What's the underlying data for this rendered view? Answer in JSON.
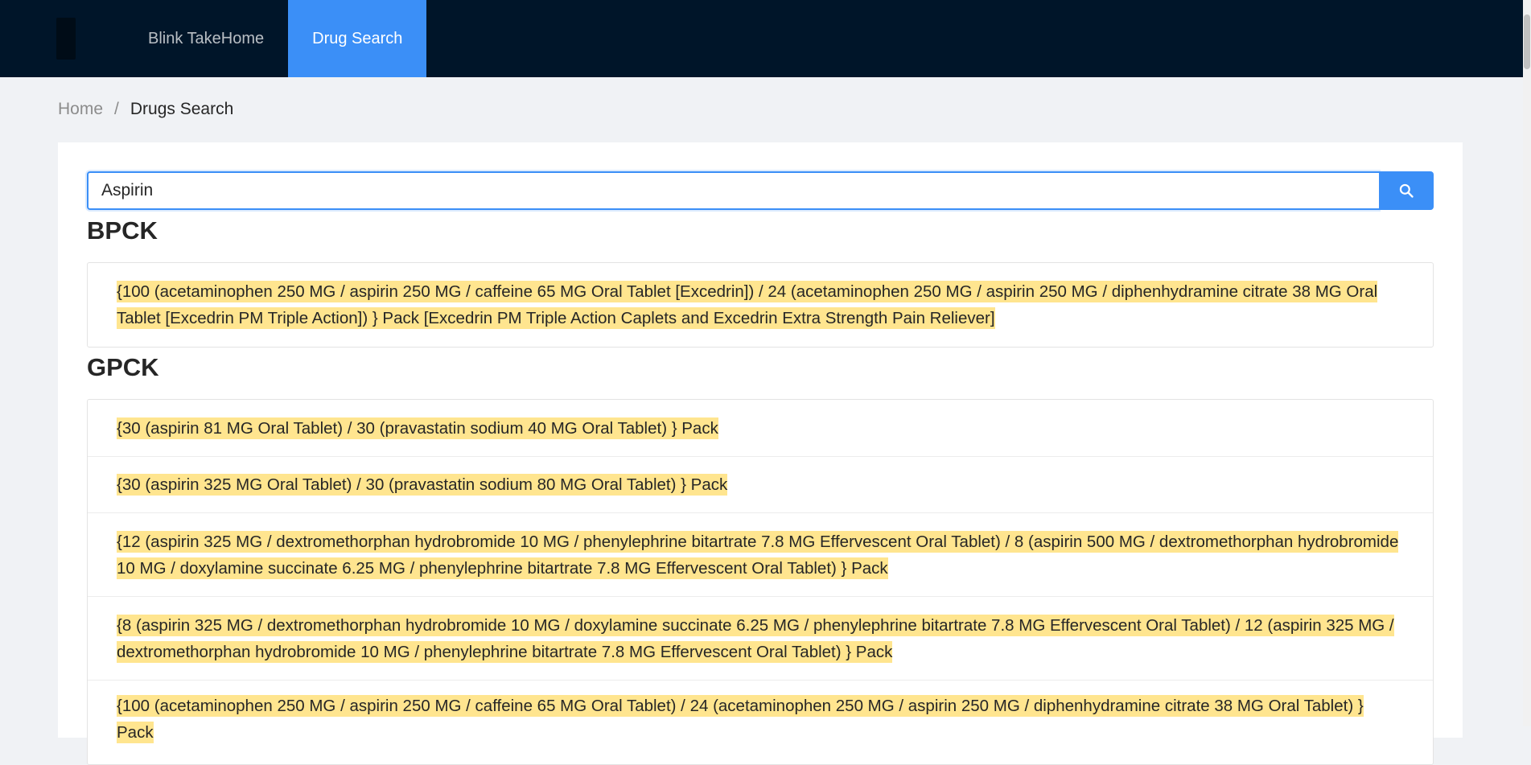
{
  "header": {
    "nav": [
      {
        "label": "Blink TakeHome",
        "active": false
      },
      {
        "label": "Drug Search",
        "active": true
      }
    ]
  },
  "breadcrumb": {
    "home": "Home",
    "separator": "/",
    "current": "Drugs Search"
  },
  "search": {
    "value": "Aspirin",
    "button_icon": "search-icon"
  },
  "sections": [
    {
      "title": "BPCK",
      "items": [
        "{100 (acetaminophen 250 MG / aspirin 250 MG / caffeine 65 MG Oral Tablet [Excedrin]) / 24 (acetaminophen 250 MG / aspirin 250 MG / diphenhydramine citrate 38 MG Oral Tablet [Excedrin PM Triple Action]) } Pack [Excedrin PM Triple Action Caplets and Excedrin Extra Strength Pain Reliever]"
      ]
    },
    {
      "title": "GPCK",
      "items": [
        "{30 (aspirin 81 MG Oral Tablet) / 30 (pravastatin sodium 40 MG Oral Tablet) } Pack",
        "{30 (aspirin 325 MG Oral Tablet) / 30 (pravastatin sodium 80 MG Oral Tablet) } Pack",
        "{12 (aspirin 325 MG / dextromethorphan hydrobromide 10 MG / phenylephrine bitartrate 7.8 MG Effervescent Oral Tablet) / 8 (aspirin 500 MG / dextromethorphan hydrobromide 10 MG / doxylamine succinate 6.25 MG / phenylephrine bitartrate 7.8 MG Effervescent Oral Tablet) } Pack",
        "{8 (aspirin 325 MG / dextromethorphan hydrobromide 10 MG / doxylamine succinate 6.25 MG / phenylephrine bitartrate 7.8 MG Effervescent Oral Tablet) / 12 (aspirin 325 MG / dextromethorphan hydrobromide 10 MG / phenylephrine bitartrate 7.8 MG Effervescent Oral Tablet) } Pack",
        "{100 (acetaminophen 250 MG / aspirin 250 MG / caffeine 65 MG Oral Tablet) / 24 (acetaminophen 250 MG / aspirin 250 MG / diphenhydramine citrate 38 MG Oral Tablet) } Pack"
      ]
    }
  ],
  "colors": {
    "header_bg": "#001529",
    "active_nav": "#3b8ff7",
    "highlight": "#ffe58f",
    "page_bg": "#f0f2f5"
  }
}
